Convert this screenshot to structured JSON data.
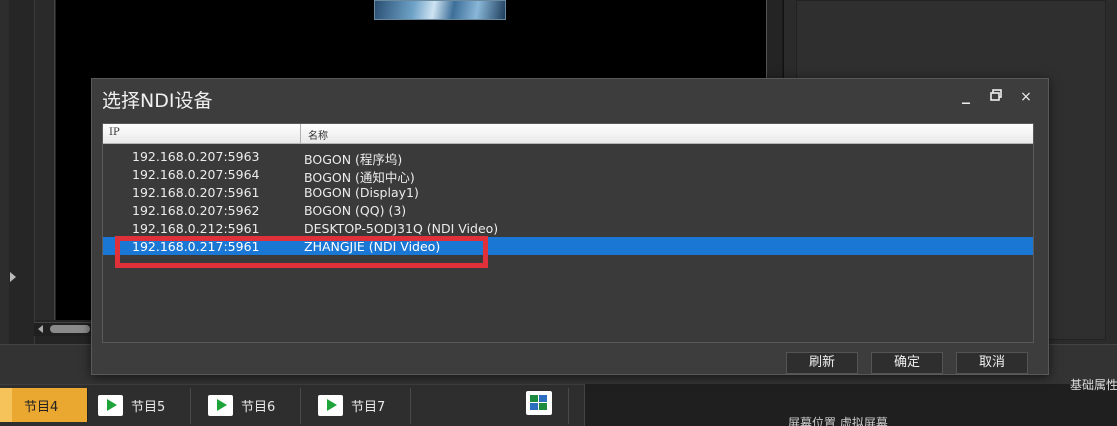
{
  "dialog": {
    "title": "选择NDI设备",
    "window_controls": {
      "minimize": "_",
      "restore": "🗗",
      "close": "×"
    },
    "columns": {
      "ip": "IP",
      "name": "名称"
    },
    "rows": [
      {
        "ip": "192.168.0.207:5963",
        "name": "BOGON (程序坞)"
      },
      {
        "ip": "192.168.0.207:5964",
        "name": "BOGON (通知中心)"
      },
      {
        "ip": "192.168.0.207:5961",
        "name": "BOGON (Display1)"
      },
      {
        "ip": "192.168.0.207:5962",
        "name": "BOGON (QQ) (3)"
      },
      {
        "ip": "192.168.0.212:5961",
        "name": "DESKTOP-5ODJ31Q (NDI Video)"
      },
      {
        "ip": "192.168.0.217:5961",
        "name": "ZHANGJIE (NDI Video)"
      }
    ],
    "selected_row_index": 5,
    "buttons": {
      "refresh": "刷新",
      "ok": "确定",
      "cancel": "取消"
    }
  },
  "program_bar": {
    "active": "节目4",
    "programs": [
      "节目5",
      "节目6",
      "节目7"
    ]
  },
  "props_panel": {
    "tab": "基础属性",
    "screen_position_label": "屏幕位置 虚拟屏幕"
  },
  "colors": {
    "selection": "#1a77d4",
    "highlight_box": "#e0303a",
    "active_program": "#eba830",
    "play_icon": "#1fa33b"
  }
}
